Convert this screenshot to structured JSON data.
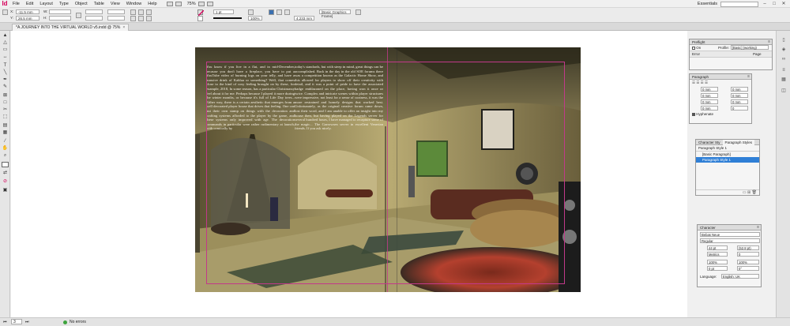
{
  "app": {
    "logo": "Id",
    "menus": [
      "File",
      "Edit",
      "Layout",
      "Type",
      "Object",
      "Table",
      "View",
      "Window",
      "Help"
    ],
    "zoom": "75%",
    "workspace": "Essentials",
    "search_placeholder": "",
    "win_min": "–",
    "win_max": "□",
    "win_close": "✕"
  },
  "control": {
    "x_label": "X:",
    "x_value": "-11.5 mm",
    "y_label": "Y:",
    "y_value": "26.5 mm",
    "w_label": "W:",
    "h_label": "H:",
    "stroke_weight": "1 pt",
    "opacity": "100%",
    "dimension": "4.233 mm",
    "frame_style": "[Basic Graphics Frame]",
    "fill_color": "#d6005a"
  },
  "document": {
    "tab_title": "*A JOURNEY INTO THE VIRTUAL WORLD v5.indd @ 75%",
    "close": "×"
  },
  "article": {
    "col1": "You know if you live in a flat, and in mid-December, because you don't have a fireplace, you have to put a YouTube video of burning logs on your telly, and have a massive drink of Kahlua or something? Well, that comes close to the kind of cosy feeling brought on by these, for example, 2018, In some reason, has a particular Christmassy feel about it for me. Perhaps because I played it more during the winter months, or because it's full of Life Day trees... Either way, there is a certain aesthetic that emerges from a well decorated player house that drives that feeling. One can put their own stamp on things with the decoration and crafting systems afforded to the player by the game, and these systems only improved with age. The decoration commands in particular were rather rudimentary at launch, with comically by",
    "col2": "today's standards, but with steep in mind, great things can be accomplished. Back in the day in the old SOE forums there was a competition known as the Galactic Home Show, and this allowed for players to show off their creativity with detail, and it was a point of pride to have the associated badge emblazoned on the place, having won it once or twice. Complex and intricate scenes within player structures were impressive, not least for a sense of coziness, it was the more restrained and homely designs that worked best. Unfortunately, as the original creative forum came down, lost their word, and I am unable to offer an insight into my house then, but having played on the Legends server for several hundred hours, I have managed to recapture some of the magic... The Garrowsen server in excellent Venerian friends. If you ask nicely."
  },
  "preflight": {
    "title": "Preflight",
    "on_label": "On",
    "profile_label": "Profile:",
    "profile_value": "[Basic] (working)",
    "col_error": "Error",
    "col_page": "Page"
  },
  "paragraph": {
    "title": "Paragraph",
    "values": [
      "0 mm",
      "0 mm",
      "0 mm",
      "0 mm",
      "0 mm",
      "0 mm",
      "0 mm",
      "0"
    ],
    "hyphenate": "Hyphenate"
  },
  "pstyles": {
    "tab1": "Character Sty",
    "tab2": "Paragraph Styles",
    "current": "Paragraph Style 1",
    "items": [
      "[Basic Paragraph]",
      "Paragraph Style 1"
    ]
  },
  "character": {
    "title": "Character",
    "font": "Bebas Neue",
    "style": "Regular",
    "size": "44 pt",
    "leading": "(52.8 pt)",
    "kerning": "Metrics",
    "tracking": "0",
    "vscale": "100%",
    "hscale": "100%",
    "baseline": "0 pt",
    "skew": "0°",
    "language_label": "Language:",
    "language": "English: UK"
  },
  "status": {
    "page": "3",
    "errors": "No errors"
  }
}
